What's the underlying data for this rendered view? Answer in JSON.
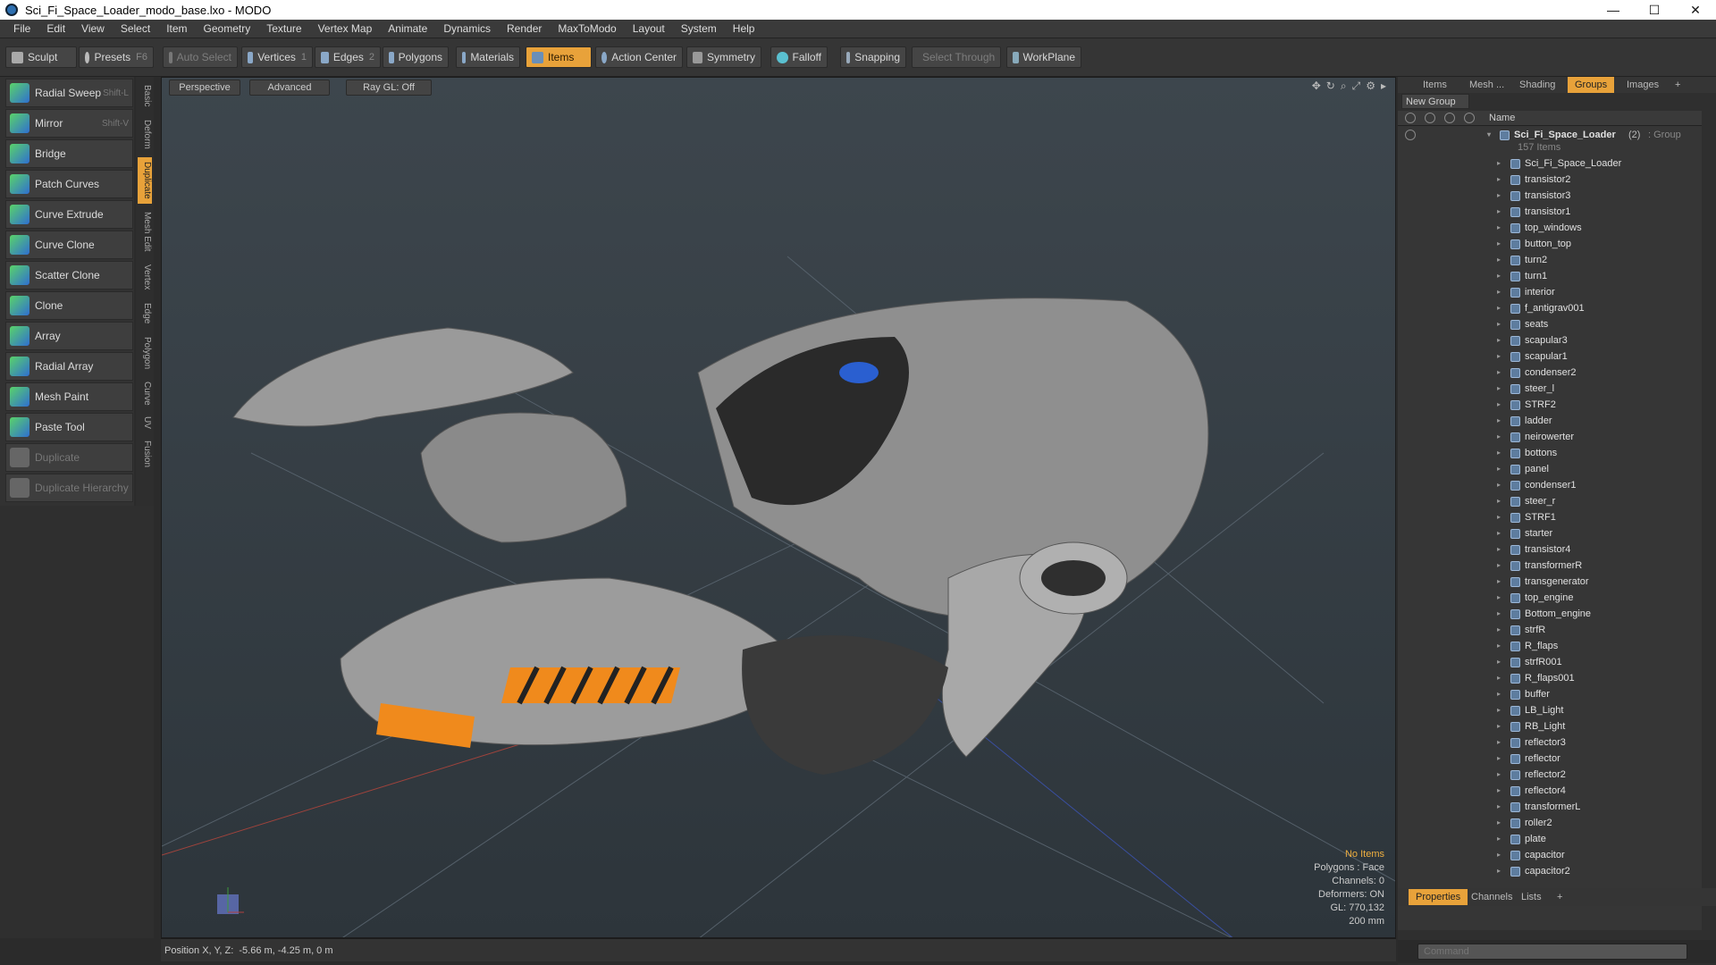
{
  "window": {
    "title": "Sci_Fi_Space_Loader_modo_base.lxo - MODO",
    "minimize": "—",
    "maximize": "☐",
    "close": "✕"
  },
  "menu": [
    "File",
    "Edit",
    "View",
    "Select",
    "Item",
    "Geometry",
    "Texture",
    "Vertex Map",
    "Animate",
    "Dynamics",
    "Render",
    "MaxToModo",
    "Layout",
    "System",
    "Help"
  ],
  "toolbar": {
    "sculpt": "Sculpt",
    "presets": "Presets",
    "presets_key": "F6",
    "auto_select": "Auto Select",
    "vertices": "Vertices",
    "vertices_count": "1",
    "edges": "Edges",
    "edges_count": "2",
    "polygons": "Polygons",
    "materials": "Materials",
    "items": "Items",
    "action_center": "Action Center",
    "symmetry": "Symmetry",
    "falloff": "Falloff",
    "snapping": "Snapping",
    "select_through": "Select Through",
    "workplane": "WorkPlane"
  },
  "tools": [
    {
      "label": "Radial Sweep",
      "shortcut": "Shift-L"
    },
    {
      "label": "Mirror",
      "shortcut": "Shift-V"
    },
    {
      "label": "Bridge",
      "shortcut": ""
    },
    {
      "label": "Patch Curves",
      "shortcut": ""
    },
    {
      "label": "Curve Extrude",
      "shortcut": ""
    },
    {
      "label": "Curve Clone",
      "shortcut": ""
    },
    {
      "label": "Scatter Clone",
      "shortcut": ""
    },
    {
      "label": "Clone",
      "shortcut": ""
    },
    {
      "label": "Array",
      "shortcut": ""
    },
    {
      "label": "Radial Array",
      "shortcut": ""
    },
    {
      "label": "Mesh Paint",
      "shortcut": ""
    },
    {
      "label": "Paste Tool",
      "shortcut": ""
    },
    {
      "label": "Duplicate",
      "shortcut": ""
    },
    {
      "label": "Duplicate Hierarchy",
      "shortcut": ""
    }
  ],
  "vtabs": [
    "Basic",
    "Deform",
    "Duplicate",
    "Mesh Edit",
    "Vertex",
    "Edge",
    "Polygon",
    "Curve",
    "UV",
    "Fusion"
  ],
  "viewport": {
    "view": "Perspective",
    "shading": "Advanced",
    "raygl": "Ray GL: Off",
    "info": {
      "no_items": "No Items",
      "polygons": "Polygons : Face",
      "channels": "Channels: 0",
      "deformers": "Deformers: ON",
      "gl": "GL: 770,132",
      "scale": "200 mm"
    }
  },
  "status": {
    "position_label": "Position X, Y, Z:",
    "position_value": "-5.66 m, -4.25 m, 0 m"
  },
  "right_tabs": [
    "Items",
    "Mesh ...",
    "Shading",
    "Groups",
    "Images",
    "+"
  ],
  "new_group": "New Group",
  "name_header": "Name",
  "group": {
    "name": "Sci_Fi_Space_Loader",
    "count": "(2)",
    "type": ": Group",
    "items": "157 Items"
  },
  "tree_items": [
    "Sci_Fi_Space_Loader",
    "transistor2",
    "transistor3",
    "transistor1",
    "top_windows",
    "button_top",
    "turn2",
    "turn1",
    "interior",
    "f_antigrav001",
    "seats",
    "scapular3",
    "scapular1",
    "condenser2",
    "steer_l",
    "STRF2",
    "ladder",
    "neirowerter",
    "bottons",
    "panel",
    "condenser1",
    "steer_r",
    "STRF1",
    "starter",
    "transistor4",
    "transformerR",
    "transgenerator",
    "top_engine",
    "Bottom_engine",
    "strfR",
    "R_flaps",
    "strfR001",
    "R_flaps001",
    "buffer",
    "LB_Light",
    "RB_Light",
    "reflector3",
    "reflector",
    "reflector2",
    "reflector4",
    "transformerL",
    "roller2",
    "plate",
    "capacitor",
    "capacitor2"
  ],
  "bottom_tabs": [
    "Properties",
    "Channels",
    "Lists",
    "+"
  ],
  "command": {
    "placeholder": "Command"
  },
  "colors": {
    "accent": "#e8a23a",
    "panel": "#2f2f2f",
    "viewport": "#3a4248"
  }
}
